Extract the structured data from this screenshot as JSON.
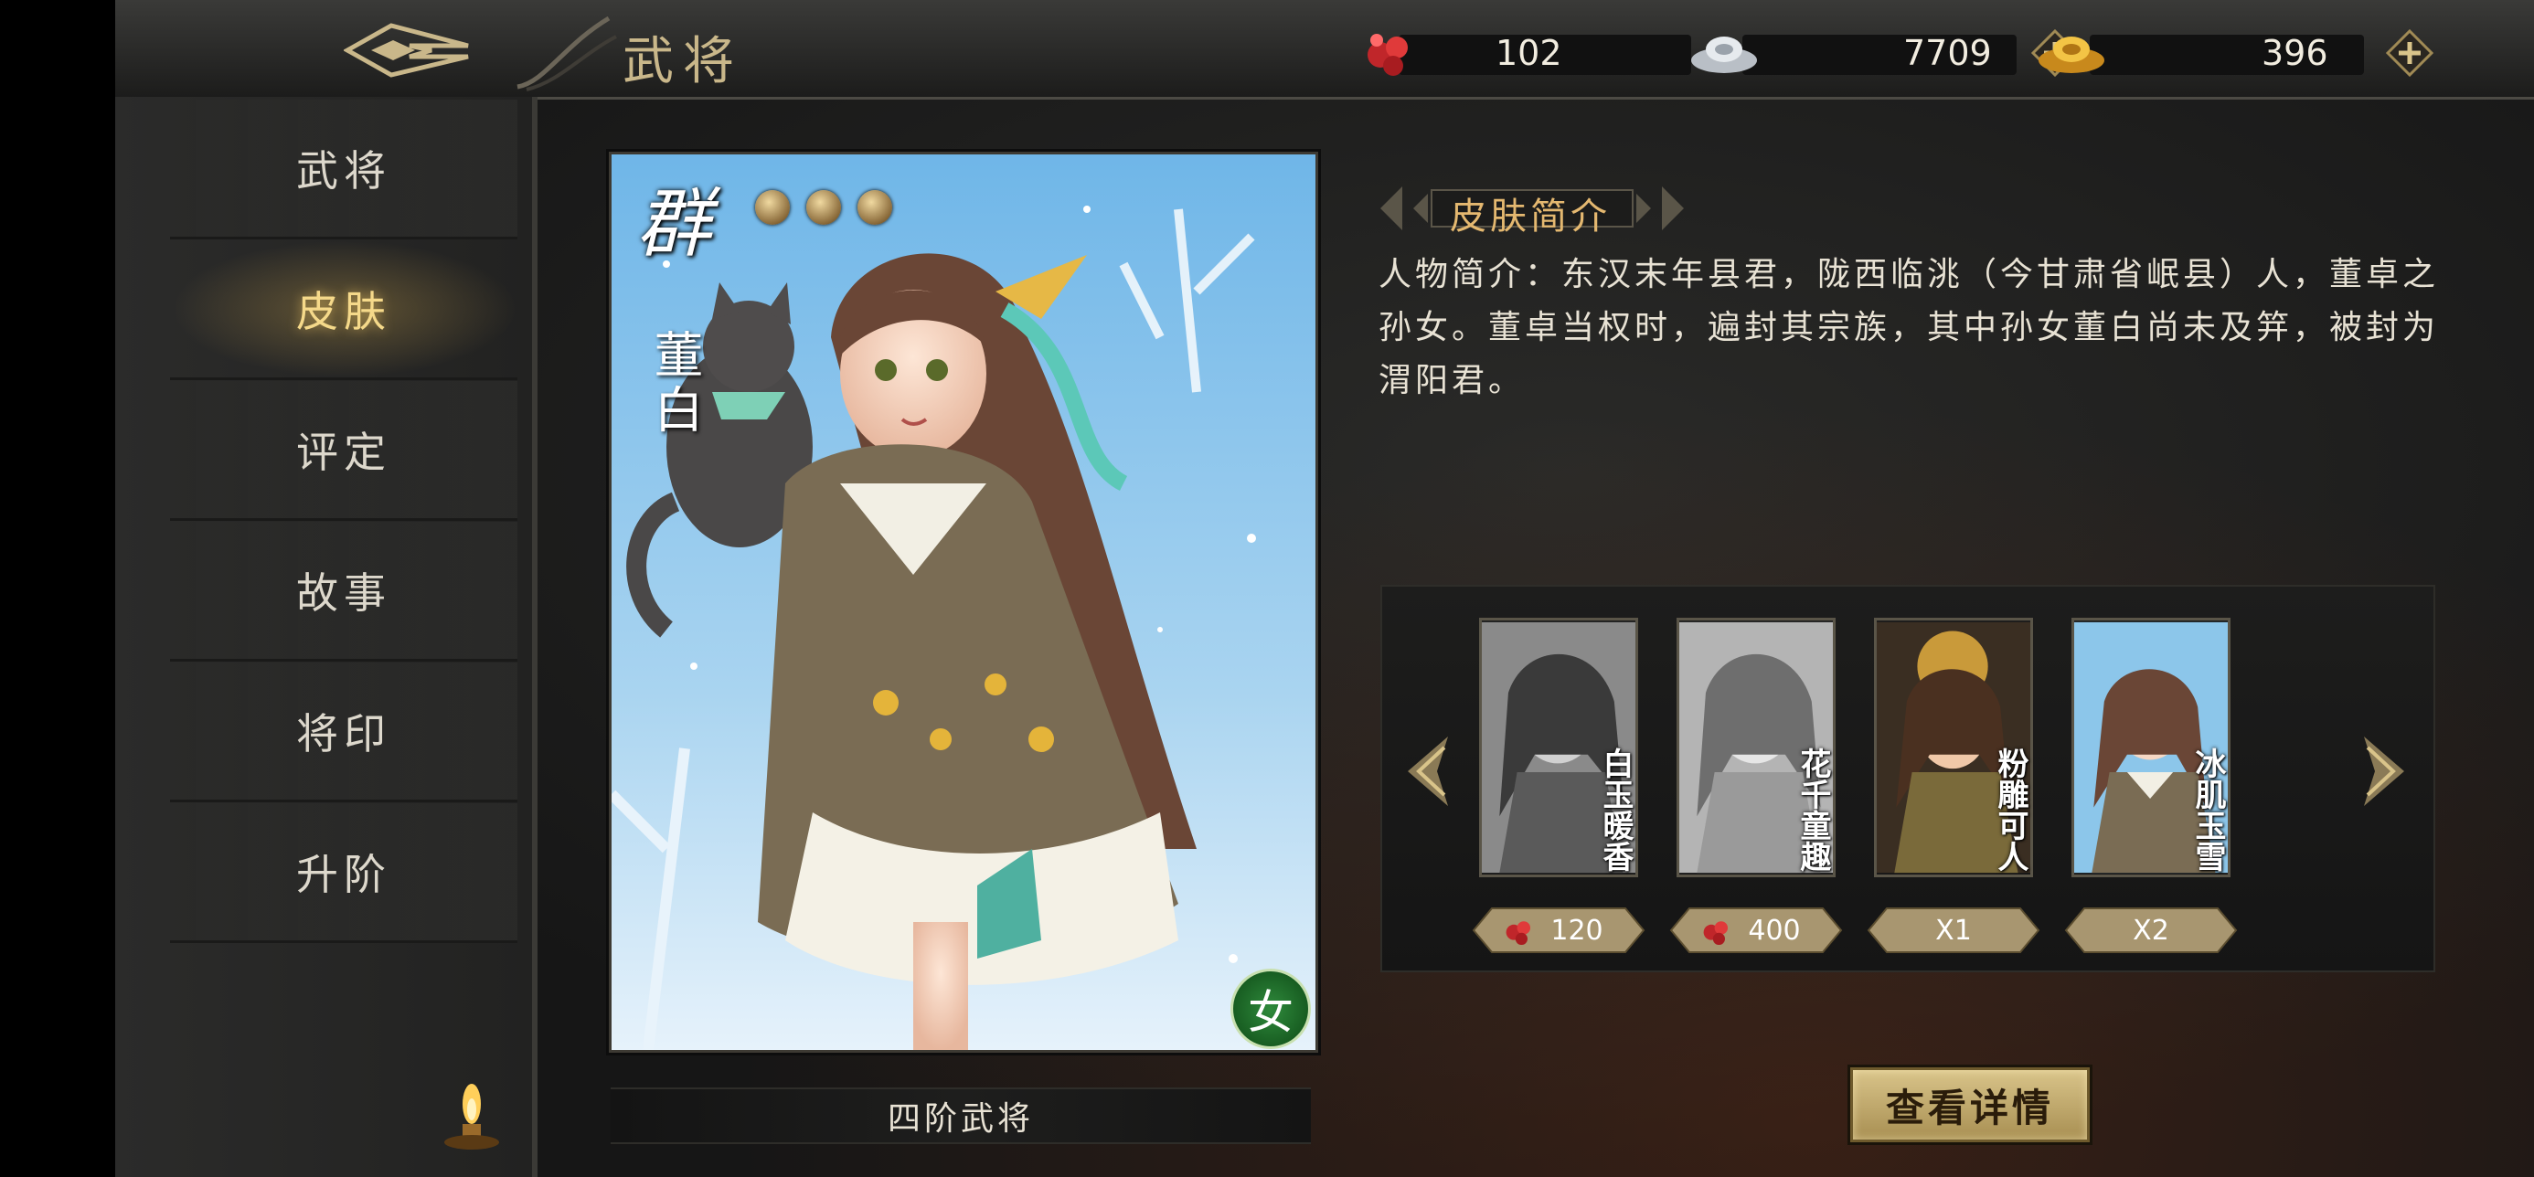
{
  "header": {
    "title": "武将",
    "resources": [
      {
        "icon": "gem-cluster-icon",
        "value": "102",
        "has_plus": false
      },
      {
        "icon": "silver-ingot-icon",
        "value": "7709",
        "has_plus": true
      },
      {
        "icon": "gold-ingot-icon",
        "value": "396",
        "has_plus": true
      }
    ]
  },
  "sidebar": {
    "items": [
      {
        "label": "武将",
        "active": false
      },
      {
        "label": "皮肤",
        "active": true
      },
      {
        "label": "评定",
        "active": false
      },
      {
        "label": "故事",
        "active": false
      },
      {
        "label": "将印",
        "active": false
      },
      {
        "label": "升阶",
        "active": false
      }
    ]
  },
  "card": {
    "faction": "群",
    "stars": 3,
    "name": "董白",
    "gender": "女",
    "rank": "四阶武将"
  },
  "skin_intro": {
    "title": "皮肤简介",
    "description": "人物简介：东汉末年县君，陇西临洮（今甘肃省岷县）人，董卓之孙女。董卓当权时，遍封其宗族，其中孙女董白尚未及笄，被封为渭阳君。"
  },
  "skins": [
    {
      "name": "白玉暖香",
      "price": "120",
      "price_icon": "gem-cluster-icon",
      "grayscale": true
    },
    {
      "name": "花千童趣",
      "price": "400",
      "price_icon": "gem-cluster-icon",
      "grayscale": true
    },
    {
      "name": "粉雕可人",
      "price": "X1",
      "price_icon": "",
      "grayscale": false
    },
    {
      "name": "冰肌玉雪",
      "price": "X2",
      "price_icon": "",
      "grayscale": false
    }
  ],
  "detail_button": "查看详情",
  "colors": {
    "accent_gold": "#e4b870",
    "active_nav": "#f5d98a",
    "gender_green": "#2f8a3c"
  }
}
